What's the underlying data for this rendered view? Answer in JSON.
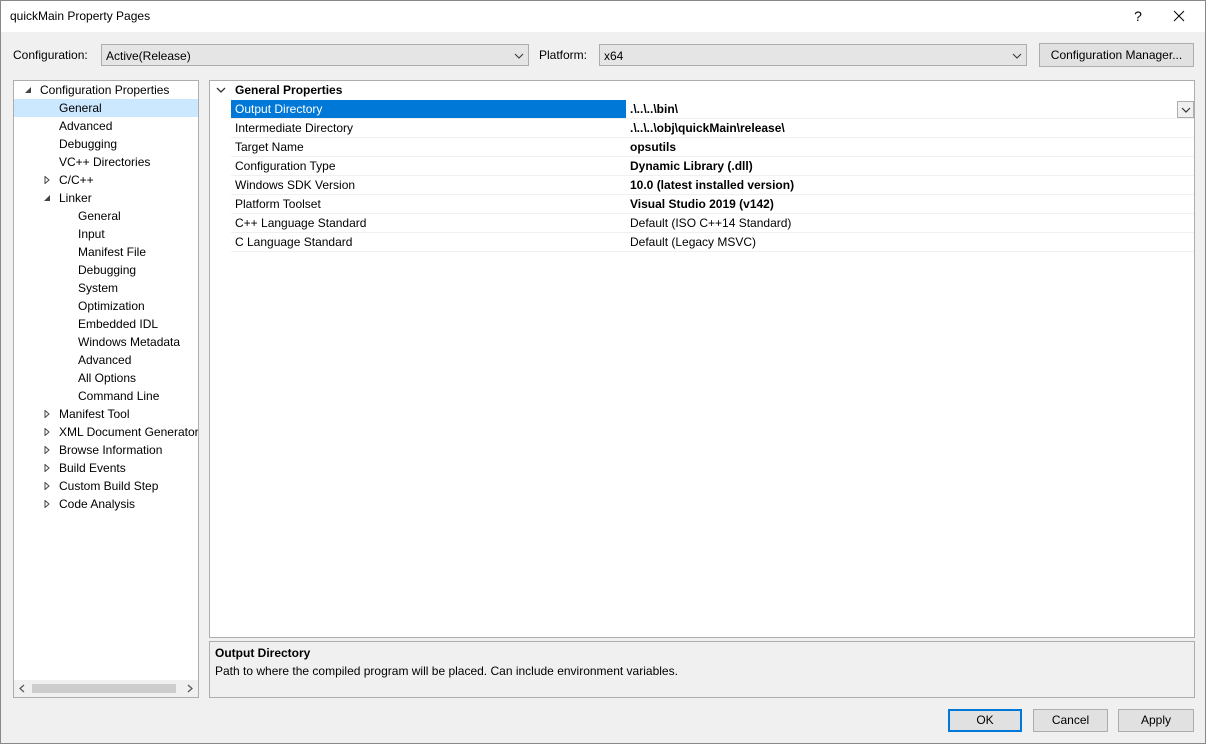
{
  "window": {
    "title": "quickMain Property Pages",
    "help_glyph": "?",
    "close_glyph": "✕"
  },
  "config_bar": {
    "configuration_label": "Configuration:",
    "configuration_value": "Active(Release)",
    "platform_label": "Platform:",
    "platform_value": "x64",
    "config_manager_button": "Configuration Manager..."
  },
  "tree": {
    "items": [
      {
        "label": "Configuration Properties",
        "level": 0,
        "expander": "expanded",
        "selected": false
      },
      {
        "label": "General",
        "level": 1,
        "expander": "none",
        "selected": true
      },
      {
        "label": "Advanced",
        "level": 1,
        "expander": "none",
        "selected": false
      },
      {
        "label": "Debugging",
        "level": 1,
        "expander": "none",
        "selected": false
      },
      {
        "label": "VC++ Directories",
        "level": 1,
        "expander": "none",
        "selected": false
      },
      {
        "label": "C/C++",
        "level": 1,
        "expander": "collapsed",
        "selected": false
      },
      {
        "label": "Linker",
        "level": 1,
        "expander": "expanded",
        "selected": false
      },
      {
        "label": "General",
        "level": 2,
        "expander": "none",
        "selected": false
      },
      {
        "label": "Input",
        "level": 2,
        "expander": "none",
        "selected": false
      },
      {
        "label": "Manifest File",
        "level": 2,
        "expander": "none",
        "selected": false
      },
      {
        "label": "Debugging",
        "level": 2,
        "expander": "none",
        "selected": false
      },
      {
        "label": "System",
        "level": 2,
        "expander": "none",
        "selected": false
      },
      {
        "label": "Optimization",
        "level": 2,
        "expander": "none",
        "selected": false
      },
      {
        "label": "Embedded IDL",
        "level": 2,
        "expander": "none",
        "selected": false
      },
      {
        "label": "Windows Metadata",
        "level": 2,
        "expander": "none",
        "selected": false
      },
      {
        "label": "Advanced",
        "level": 2,
        "expander": "none",
        "selected": false
      },
      {
        "label": "All Options",
        "level": 2,
        "expander": "none",
        "selected": false
      },
      {
        "label": "Command Line",
        "level": 2,
        "expander": "none",
        "selected": false
      },
      {
        "label": "Manifest Tool",
        "level": 1,
        "expander": "collapsed",
        "selected": false
      },
      {
        "label": "XML Document Generator",
        "level": 1,
        "expander": "collapsed",
        "selected": false
      },
      {
        "label": "Browse Information",
        "level": 1,
        "expander": "collapsed",
        "selected": false
      },
      {
        "label": "Build Events",
        "level": 1,
        "expander": "collapsed",
        "selected": false
      },
      {
        "label": "Custom Build Step",
        "level": 1,
        "expander": "collapsed",
        "selected": false
      },
      {
        "label": "Code Analysis",
        "level": 1,
        "expander": "collapsed",
        "selected": false
      }
    ]
  },
  "grid": {
    "category": "General Properties",
    "properties": [
      {
        "name": "Output Directory",
        "value": ".\\..\\..\\bin\\",
        "bold": true,
        "selected": true
      },
      {
        "name": "Intermediate Directory",
        "value": ".\\..\\..\\obj\\quickMain\\release\\",
        "bold": true,
        "selected": false
      },
      {
        "name": "Target Name",
        "value": "opsutils",
        "bold": true,
        "selected": false
      },
      {
        "name": "Configuration Type",
        "value": "Dynamic Library (.dll)",
        "bold": true,
        "selected": false
      },
      {
        "name": "Windows SDK Version",
        "value": "10.0 (latest installed version)",
        "bold": true,
        "selected": false
      },
      {
        "name": "Platform Toolset",
        "value": "Visual Studio 2019 (v142)",
        "bold": true,
        "selected": false
      },
      {
        "name": "C++ Language Standard",
        "value": "Default (ISO C++14 Standard)",
        "bold": false,
        "selected": false
      },
      {
        "name": "C Language Standard",
        "value": "Default (Legacy MSVC)",
        "bold": false,
        "selected": false
      }
    ]
  },
  "description": {
    "title": "Output Directory",
    "text": "Path to where the compiled program will be placed. Can include environment variables."
  },
  "buttons": {
    "ok": "OK",
    "cancel": "Cancel",
    "apply": "Apply"
  },
  "colors": {
    "selection_blue": "#0078d7",
    "tree_selection": "#cce8ff"
  }
}
